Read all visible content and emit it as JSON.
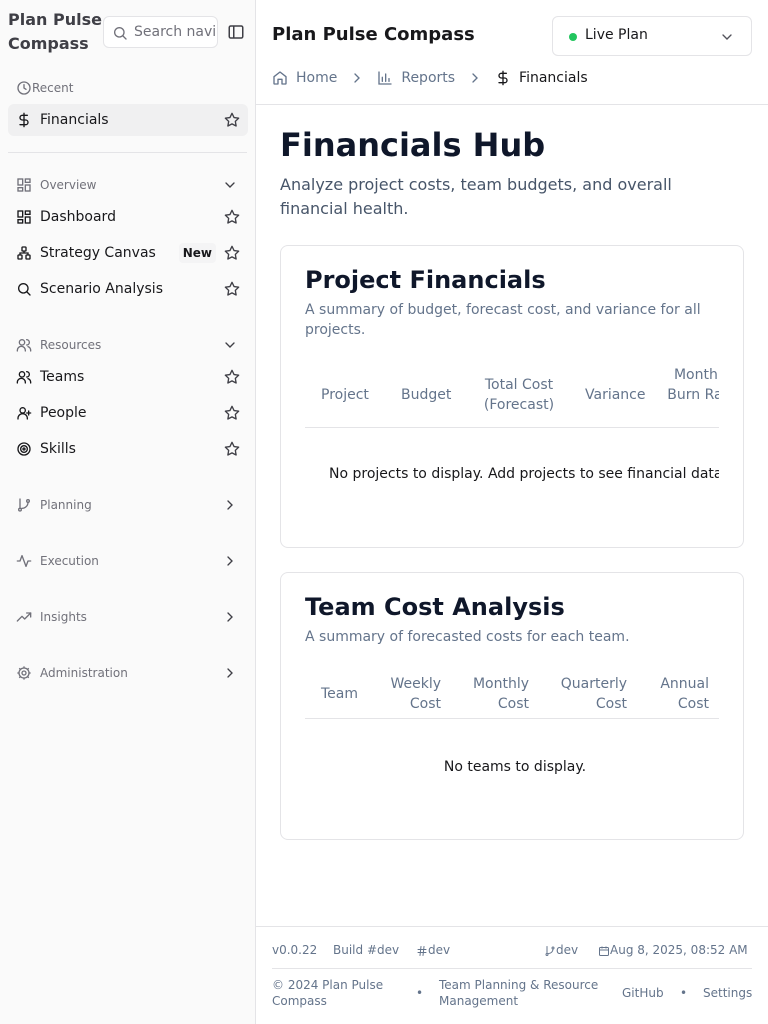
{
  "app": {
    "name": "Plan Pulse Compass"
  },
  "sidebar": {
    "search_placeholder": "Search navigation",
    "recent_label": "Recent",
    "recent_items": [
      {
        "label": "Financials",
        "icon": "dollar-icon"
      }
    ],
    "groups": {
      "overview": {
        "label": "Overview",
        "expanded": true,
        "items": [
          {
            "label": "Dashboard",
            "icon": "dashboard-icon"
          },
          {
            "label": "Strategy Canvas",
            "icon": "workflow-icon",
            "badge": "New"
          },
          {
            "label": "Scenario Analysis",
            "icon": "search-icon"
          }
        ]
      },
      "resources": {
        "label": "Resources",
        "expanded": true,
        "items": [
          {
            "label": "Teams",
            "icon": "users-icon"
          },
          {
            "label": "People",
            "icon": "user-icon"
          },
          {
            "label": "Skills",
            "icon": "target-icon"
          }
        ]
      },
      "planning": {
        "label": "Planning",
        "expanded": false
      },
      "execution": {
        "label": "Execution",
        "expanded": false
      },
      "insights": {
        "label": "Insights",
        "expanded": false
      },
      "administration": {
        "label": "Administration",
        "expanded": false
      }
    }
  },
  "header": {
    "title": "Plan Pulse Compass",
    "plan_select": {
      "value": "Live Plan",
      "status_color": "#22c55e"
    },
    "breadcrumbs": [
      {
        "label": "Home",
        "icon": "home-icon"
      },
      {
        "label": "Reports",
        "icon": "bar-chart-icon"
      },
      {
        "label": "Financials",
        "icon": "dollar-icon"
      }
    ]
  },
  "page": {
    "title": "Financials Hub",
    "subtitle": "Analyze project costs, team budgets, and overall financial health."
  },
  "project_financials": {
    "title": "Project Financials",
    "description": "A summary of budget, forecast cost, and variance for all projects.",
    "columns": [
      "Project",
      "Budget",
      "Total Cost (Forecast)",
      "Variance",
      "Monthly Burn Rate"
    ],
    "empty_message": "No projects to display. Add projects to see financial data."
  },
  "team_costs": {
    "title": "Team Cost Analysis",
    "description": "A summary of forecasted costs for each team.",
    "columns": [
      "Team",
      "Weekly Cost",
      "Monthly Cost",
      "Quarterly Cost",
      "Annual Cost"
    ],
    "empty_message": "No teams to display."
  },
  "footer": {
    "version": "v0.0.22",
    "build": "Build #dev",
    "env": "dev",
    "branch": "dev",
    "timestamp": "Aug 8, 2025, 08:52 AM",
    "copyright": "© 2024 Plan Pulse Compass",
    "tagline": "Team Planning & Resource Management",
    "links": [
      "GitHub",
      "Settings"
    ],
    "separator": "•"
  }
}
